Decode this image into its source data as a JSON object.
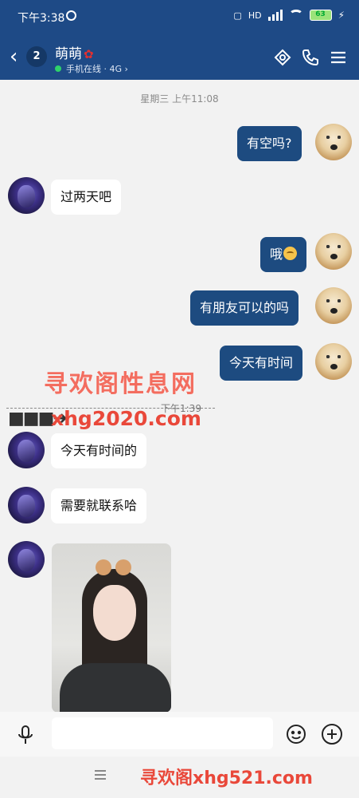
{
  "status_bar": {
    "time": "下午3:38",
    "network": "HD",
    "battery": "63"
  },
  "header": {
    "unread_count": "2",
    "contact_name": "萌萌",
    "status_text": "手机在线 · 4G"
  },
  "chat": {
    "timestamp_1": "星期三 上午11:08",
    "messages": [
      {
        "side": "out",
        "text": "有空吗?"
      },
      {
        "side": "in",
        "text": "过两天吧"
      },
      {
        "side": "out",
        "text": "哦"
      },
      {
        "side": "out",
        "text": "有朋友可以的吗"
      },
      {
        "side": "out",
        "text": "今天有时间"
      },
      {
        "side": "in",
        "text": "今天有时间的"
      },
      {
        "side": "in",
        "text": "需要就联系哈"
      }
    ],
    "timestamp_2": "下午1:39"
  },
  "watermarks": {
    "line1": "寻欢阁性息网",
    "line2": "xhg2020.com",
    "bottom": "寻欢阁xhg521.com"
  },
  "input": {
    "placeholder": ""
  },
  "colors": {
    "header_bg": "#1e4a86",
    "outgoing_bubble": "#1d4b80",
    "incoming_bubble": "#ffffff",
    "background": "#f2f2f2"
  }
}
